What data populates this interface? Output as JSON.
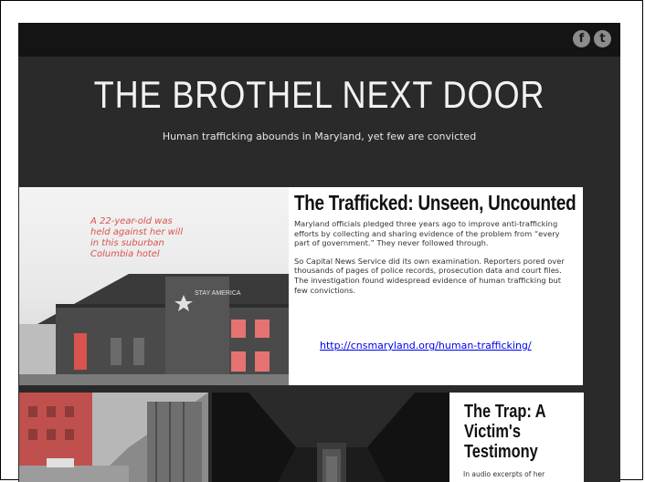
{
  "social": {
    "facebook_glyph": "f",
    "twitter_glyph": "t"
  },
  "hero": {
    "title": "THE BROTHEL NEXT DOOR",
    "subtitle": "Human trafficking abounds in Maryland, yet few are convicted"
  },
  "story1": {
    "caption": "A 22-year-old was held against her will in this suburban Columbia hotel",
    "sign": "STAY AMERICA",
    "title": "The Trafficked: Unseen, Uncounted",
    "p1": "Maryland officials pledged three years ago to improve anti-trafficking efforts by collecting and sharing evidence of the problem from “every part of government.” They never followed through.",
    "p2": "So Capital News Service did its own examination. Reporters pored over thousands of pages of police records, prosecution data and court files. The investigation found widespread evidence of human trafficking but few convictions.",
    "link": "http://cnsmaryland.org/human-trafficking/"
  },
  "story2": {
    "title": "The Trap: A Victim's Testimony",
    "excerpt": "In audio excerpts of her"
  },
  "colors": {
    "page_bg": "#2a2a2a",
    "topbar": "#141414",
    "caption_red": "#d9534f",
    "link_blue": "#0000ee"
  }
}
